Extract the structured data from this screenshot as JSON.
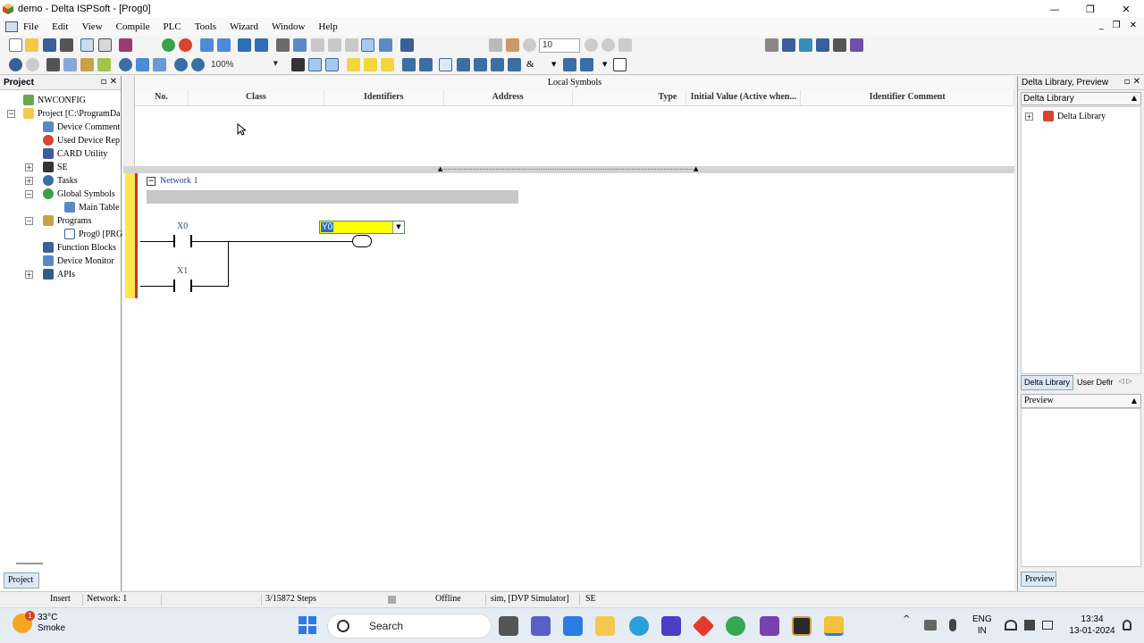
{
  "window": {
    "title": "demo - Delta ISPSoft - [Prog0]",
    "controls": [
      "—",
      "❐",
      "✕"
    ]
  },
  "menubar": {
    "items": [
      "File",
      "Edit",
      "View",
      "Compile",
      "PLC",
      "Tools",
      "Wizard",
      "Window",
      "Help"
    ],
    "mdi_controls": [
      "_",
      "❐",
      "✕"
    ]
  },
  "toolbar": {
    "zoom_value": "100%",
    "step_value": "10",
    "ampersand": "&"
  },
  "project_panel": {
    "title": "Project",
    "header_controls": "▫ ✕",
    "tree": [
      {
        "label": "NWCONFIG",
        "icon": "network-config-icon"
      },
      {
        "label": "Project [C:\\ProgramDa",
        "icon": "project-icon"
      },
      {
        "label": "Device Comment",
        "icon": "device-comment-icon"
      },
      {
        "label": "Used Device Rep",
        "icon": "used-device-icon"
      },
      {
        "label": "CARD Utility",
        "icon": "card-utility-icon"
      },
      {
        "label": "SE",
        "icon": "se-icon"
      },
      {
        "label": "Tasks",
        "icon": "tasks-icon"
      },
      {
        "label": "Global Symbols",
        "icon": "global-symbols-icon"
      },
      {
        "label": "Main Table",
        "icon": "table-icon"
      },
      {
        "label": "Programs",
        "icon": "programs-icon"
      },
      {
        "label": "Prog0 [PRG",
        "icon": "program-icon"
      },
      {
        "label": "Function Blocks",
        "icon": "function-blocks-icon"
      },
      {
        "label": "Device Monitor",
        "icon": "device-monitor-icon"
      },
      {
        "label": "APIs",
        "icon": "apis-icon"
      }
    ],
    "bottom_tab": "Project"
  },
  "local_symbols": {
    "title": "Local Symbols",
    "columns": [
      "No.",
      "Class",
      "Identifiers",
      "Address",
      "Type",
      "Initial Value (Active when...",
      "Identifier Comment"
    ]
  },
  "ladder": {
    "network_label": "Network 1",
    "collapse_symbol": "−",
    "contacts": [
      "X0",
      "X1"
    ],
    "coil_input": "Y0"
  },
  "right_panel": {
    "title": "Delta Library, Preview",
    "header_controls": "▫ ✕",
    "dropdown": "Delta Library",
    "tree_root": "Delta Library",
    "tabs": [
      "Delta Library",
      "User Defir"
    ],
    "tab_arrows": "◁ ▷",
    "preview_label": "Preview",
    "bottom_tab": "Preview"
  },
  "statusbar": {
    "mode": "Insert",
    "network": "Network: 1",
    "steps": "3/15872 Steps",
    "state": "Offline",
    "connection": "sim, [DVP Simulator]",
    "series": "SE"
  },
  "taskbar": {
    "weather_temp": "33°C",
    "weather_desc": "Smoke",
    "weather_badge": "1",
    "search_label": "Search",
    "lang": "ENG",
    "region": "IN",
    "time": "13:34",
    "date": "13-01-2024"
  },
  "colors": {
    "rail": "#fbe64d",
    "selection": "#1f6fd6",
    "coil_input_bg": "#ffff00",
    "network_text": "#2a3f9c"
  }
}
